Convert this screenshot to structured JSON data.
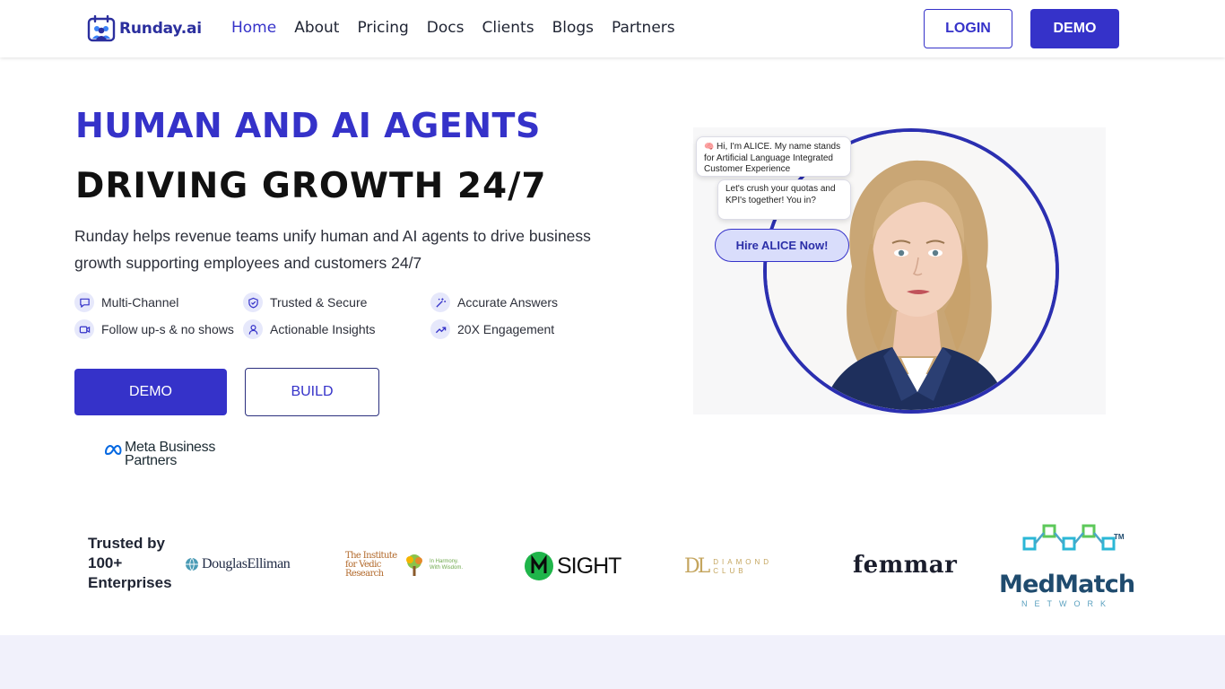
{
  "header": {
    "brand": "Runday.ai",
    "nav": [
      "Home",
      "About",
      "Pricing",
      "Docs",
      "Clients",
      "Blogs",
      "Partners"
    ],
    "active_nav": "Home",
    "login_label": "LOGIN",
    "demo_label": "DEMO"
  },
  "hero": {
    "title_primary": "HUMAN AND AI AGENTS",
    "title_secondary": "DRIVING GROWTH 24/7",
    "description": "Runday helps revenue teams unify human and AI agents to drive business growth supporting employees and customers 24/7",
    "features": [
      {
        "label": "Multi-Channel",
        "icon": "chat-icon"
      },
      {
        "label": "Trusted & Secure",
        "icon": "shield-icon"
      },
      {
        "label": "Accurate Answers",
        "icon": "magic-wand-icon"
      },
      {
        "label": "Follow up-s & no shows",
        "icon": "video-icon"
      },
      {
        "label": "Actionable Insights",
        "icon": "user-icon"
      },
      {
        "label": "20X Engagement",
        "icon": "trending-up-icon"
      }
    ],
    "demo_button": "DEMO",
    "build_button": "BUILD",
    "partner_badge_line1": "Meta Business",
    "partner_badge_line2": "Partners"
  },
  "assistant": {
    "bubble_1": "Hi, I'm ALICE. My name stands for Artificial Language Integrated Customer Experience",
    "bubble_1_emoji": "🧠",
    "bubble_2": "Let's crush your quotas and KPI's together! You in?",
    "hire_button": "Hire ALICE Now!"
  },
  "trusted": {
    "heading": "Trusted by 100+ Enterprises",
    "clients": {
      "douglas": "DouglasElliman",
      "vedic_main": "The Institute for Vedic Research",
      "vedic_tagline": "In Harmony. With Wisdom.",
      "sight": "SIGHT",
      "dl_mark": "DL",
      "dl_words": "DIAMOND CLUB",
      "femmar": "femmar",
      "medmatch": "MedMatch",
      "medmatch_sub": "NETWORK",
      "medmatch_tm": "TM"
    }
  },
  "colors": {
    "brand": "#3532c9",
    "text": "#1f2433",
    "band": "#f1f1fb"
  }
}
